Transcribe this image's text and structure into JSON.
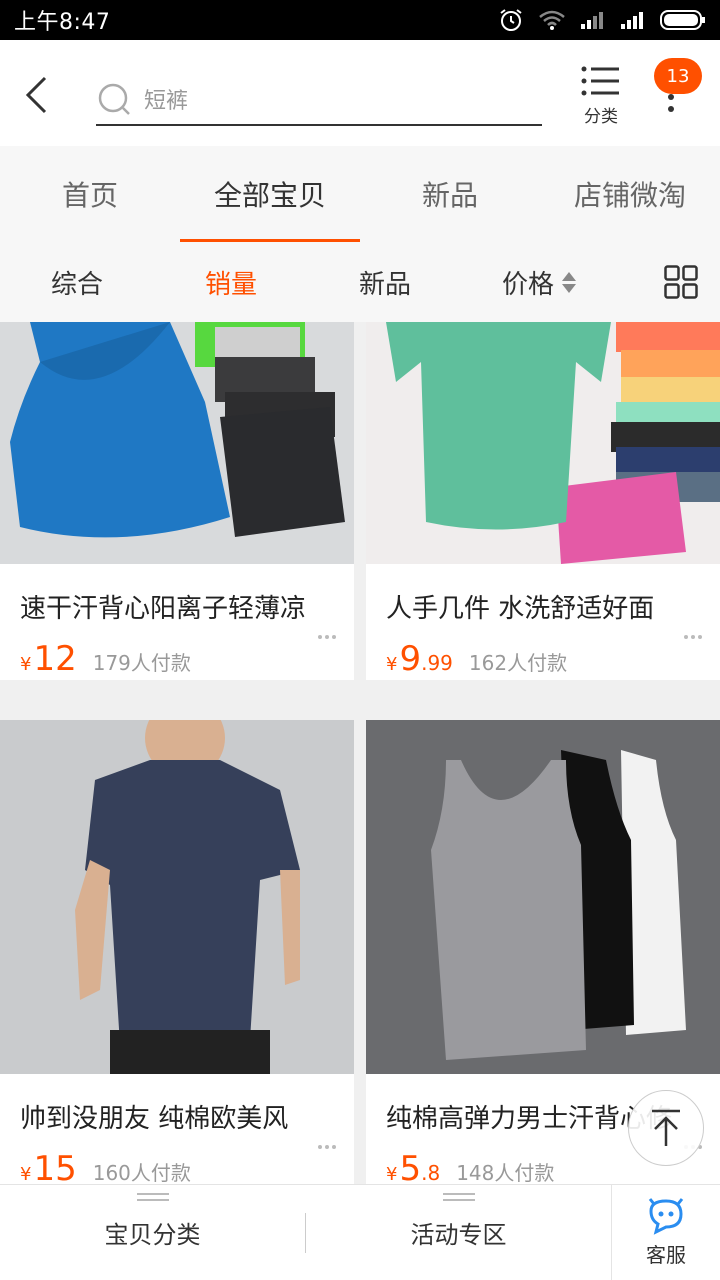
{
  "status_bar": {
    "time": "上午8:47"
  },
  "header": {
    "search_placeholder": "短裤",
    "category_label": "分类",
    "badge_count": "13"
  },
  "nav_tabs": [
    {
      "label": "首页"
    },
    {
      "label": "全部宝贝",
      "active": true
    },
    {
      "label": "新品"
    },
    {
      "label": "店铺微淘"
    }
  ],
  "sort_bar": {
    "comprehensive": "综合",
    "sales": "销量",
    "new": "新品",
    "price": "价格"
  },
  "products": [
    {
      "title": "速干汗背心阳离子轻薄凉",
      "currency": "¥",
      "price_int": "12",
      "price_dec": "",
      "sold": "179人付款",
      "image": "blue-tank-top-photo"
    },
    {
      "title": "人手几件 水洗舒适好面",
      "currency": "¥",
      "price_int": "9",
      "price_dec": ".99",
      "sold": "162人付款",
      "image": "green-tshirt-photo"
    },
    {
      "title": "帅到没朋友 纯棉欧美风",
      "currency": "¥",
      "price_int": "15",
      "price_dec": "",
      "sold": "160人付款",
      "image": "navy-tshirt-model-photo"
    },
    {
      "title": "纯棉高弹力男士汗背心修",
      "currency": "¥",
      "price_int": "5",
      "price_dec": ".8",
      "sold": "148人付款",
      "image": "tank-tops-grey-black-white-photo"
    }
  ],
  "bottom_bar": {
    "categories": "宝贝分类",
    "promotions": "活动专区",
    "service": "客服"
  },
  "colors": {
    "accent": "#ff5000",
    "text": "#333333",
    "muted": "#999999"
  }
}
